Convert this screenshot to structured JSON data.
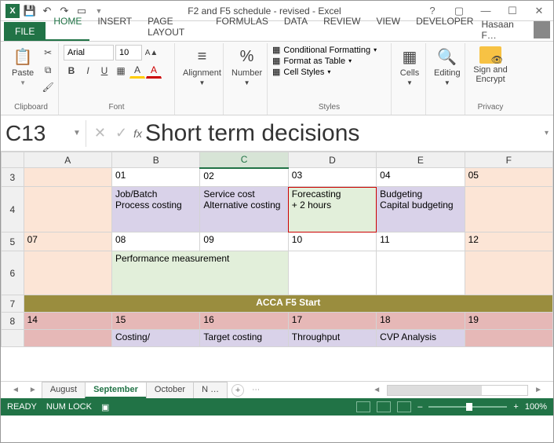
{
  "qat": {
    "title": "F2 and F5 schedule - revised - Excel"
  },
  "tabs": {
    "file": "FILE",
    "items": [
      "HOME",
      "INSERT",
      "PAGE LAYOUT",
      "FORMULAS",
      "DATA",
      "REVIEW",
      "VIEW",
      "DEVELOPER"
    ],
    "active": "HOME",
    "username": "Hasaan F…"
  },
  "ribbon": {
    "clipboard": {
      "paste": "Paste",
      "label": "Clipboard"
    },
    "font": {
      "name": "Arial",
      "size": "10",
      "label": "Font"
    },
    "alignment": {
      "btn": "Alignment"
    },
    "number": {
      "btn": "Number"
    },
    "styles": {
      "cond": "Conditional Formatting",
      "table": "Format as Table",
      "cell": "Cell Styles",
      "label": "Styles"
    },
    "cells": {
      "btn": "Cells"
    },
    "editing": {
      "btn": "Editing"
    },
    "privacy": {
      "btn": "Sign and Encrypt",
      "label": "Privacy"
    }
  },
  "namebox": "C13",
  "formula": "Short term decisions",
  "columns": [
    "",
    "A",
    "B",
    "C",
    "D",
    "E",
    "F"
  ],
  "rows": [
    {
      "num": "3",
      "height": 24,
      "cells": [
        {
          "text": "",
          "cls": "peach"
        },
        {
          "text": "01"
        },
        {
          "text": "02"
        },
        {
          "text": "03"
        },
        {
          "text": "04"
        },
        {
          "text": "05",
          "cls": "peach"
        }
      ]
    },
    {
      "num": "4",
      "height": 58,
      "cells": [
        {
          "text": "",
          "cls": "peach"
        },
        {
          "text": "Job/Batch\nProcess costing",
          "cls": "purple"
        },
        {
          "text": "Service cost\nAlternative costing",
          "cls": "purple"
        },
        {
          "text": "Forecasting\n+ 2 hours",
          "cls": "green redbox"
        },
        {
          "text": "Budgeting\nCapital budgeting",
          "cls": "purple"
        },
        {
          "text": "",
          "cls": "peach"
        }
      ]
    },
    {
      "num": "5",
      "height": 24,
      "cells": [
        {
          "text": "07",
          "cls": "peach"
        },
        {
          "text": "08"
        },
        {
          "text": "09"
        },
        {
          "text": "10"
        },
        {
          "text": "11"
        },
        {
          "text": "12",
          "cls": "peach"
        }
      ]
    },
    {
      "num": "6",
      "height": 56,
      "cells": [
        {
          "text": "",
          "cls": "peach"
        },
        {
          "text": "Performance measurement",
          "cls": "green",
          "colspan": 2
        },
        {
          "text": ""
        },
        {
          "text": ""
        },
        {
          "text": "",
          "cls": "peach"
        }
      ]
    },
    {
      "num": "7",
      "height": 22,
      "cells": [
        {
          "text": "ACCA F5 Start",
          "cls": "olive",
          "colspan": 6
        }
      ]
    },
    {
      "num": "8",
      "height": 22,
      "cells": [
        {
          "text": "14",
          "cls": "rose"
        },
        {
          "text": "15",
          "cls": "rose"
        },
        {
          "text": "16",
          "cls": "rose"
        },
        {
          "text": "17",
          "cls": "rose"
        },
        {
          "text": "18",
          "cls": "rose"
        },
        {
          "text": "19",
          "cls": "rose"
        }
      ]
    },
    {
      "num": "",
      "height": 22,
      "cells": [
        {
          "text": "",
          "cls": "rose"
        },
        {
          "text": "Costing/",
          "cls": "purple"
        },
        {
          "text": "Target costing",
          "cls": "purple"
        },
        {
          "text": "Throughput",
          "cls": "purple"
        },
        {
          "text": "CVP Analysis",
          "cls": "purple"
        },
        {
          "text": "",
          "cls": "rose"
        }
      ]
    }
  ],
  "sheets": {
    "items": [
      "August",
      "September",
      "October",
      "N …"
    ],
    "active": "September"
  },
  "status": {
    "ready": "READY",
    "numlock": "NUM LOCK",
    "zoom": "100%"
  }
}
